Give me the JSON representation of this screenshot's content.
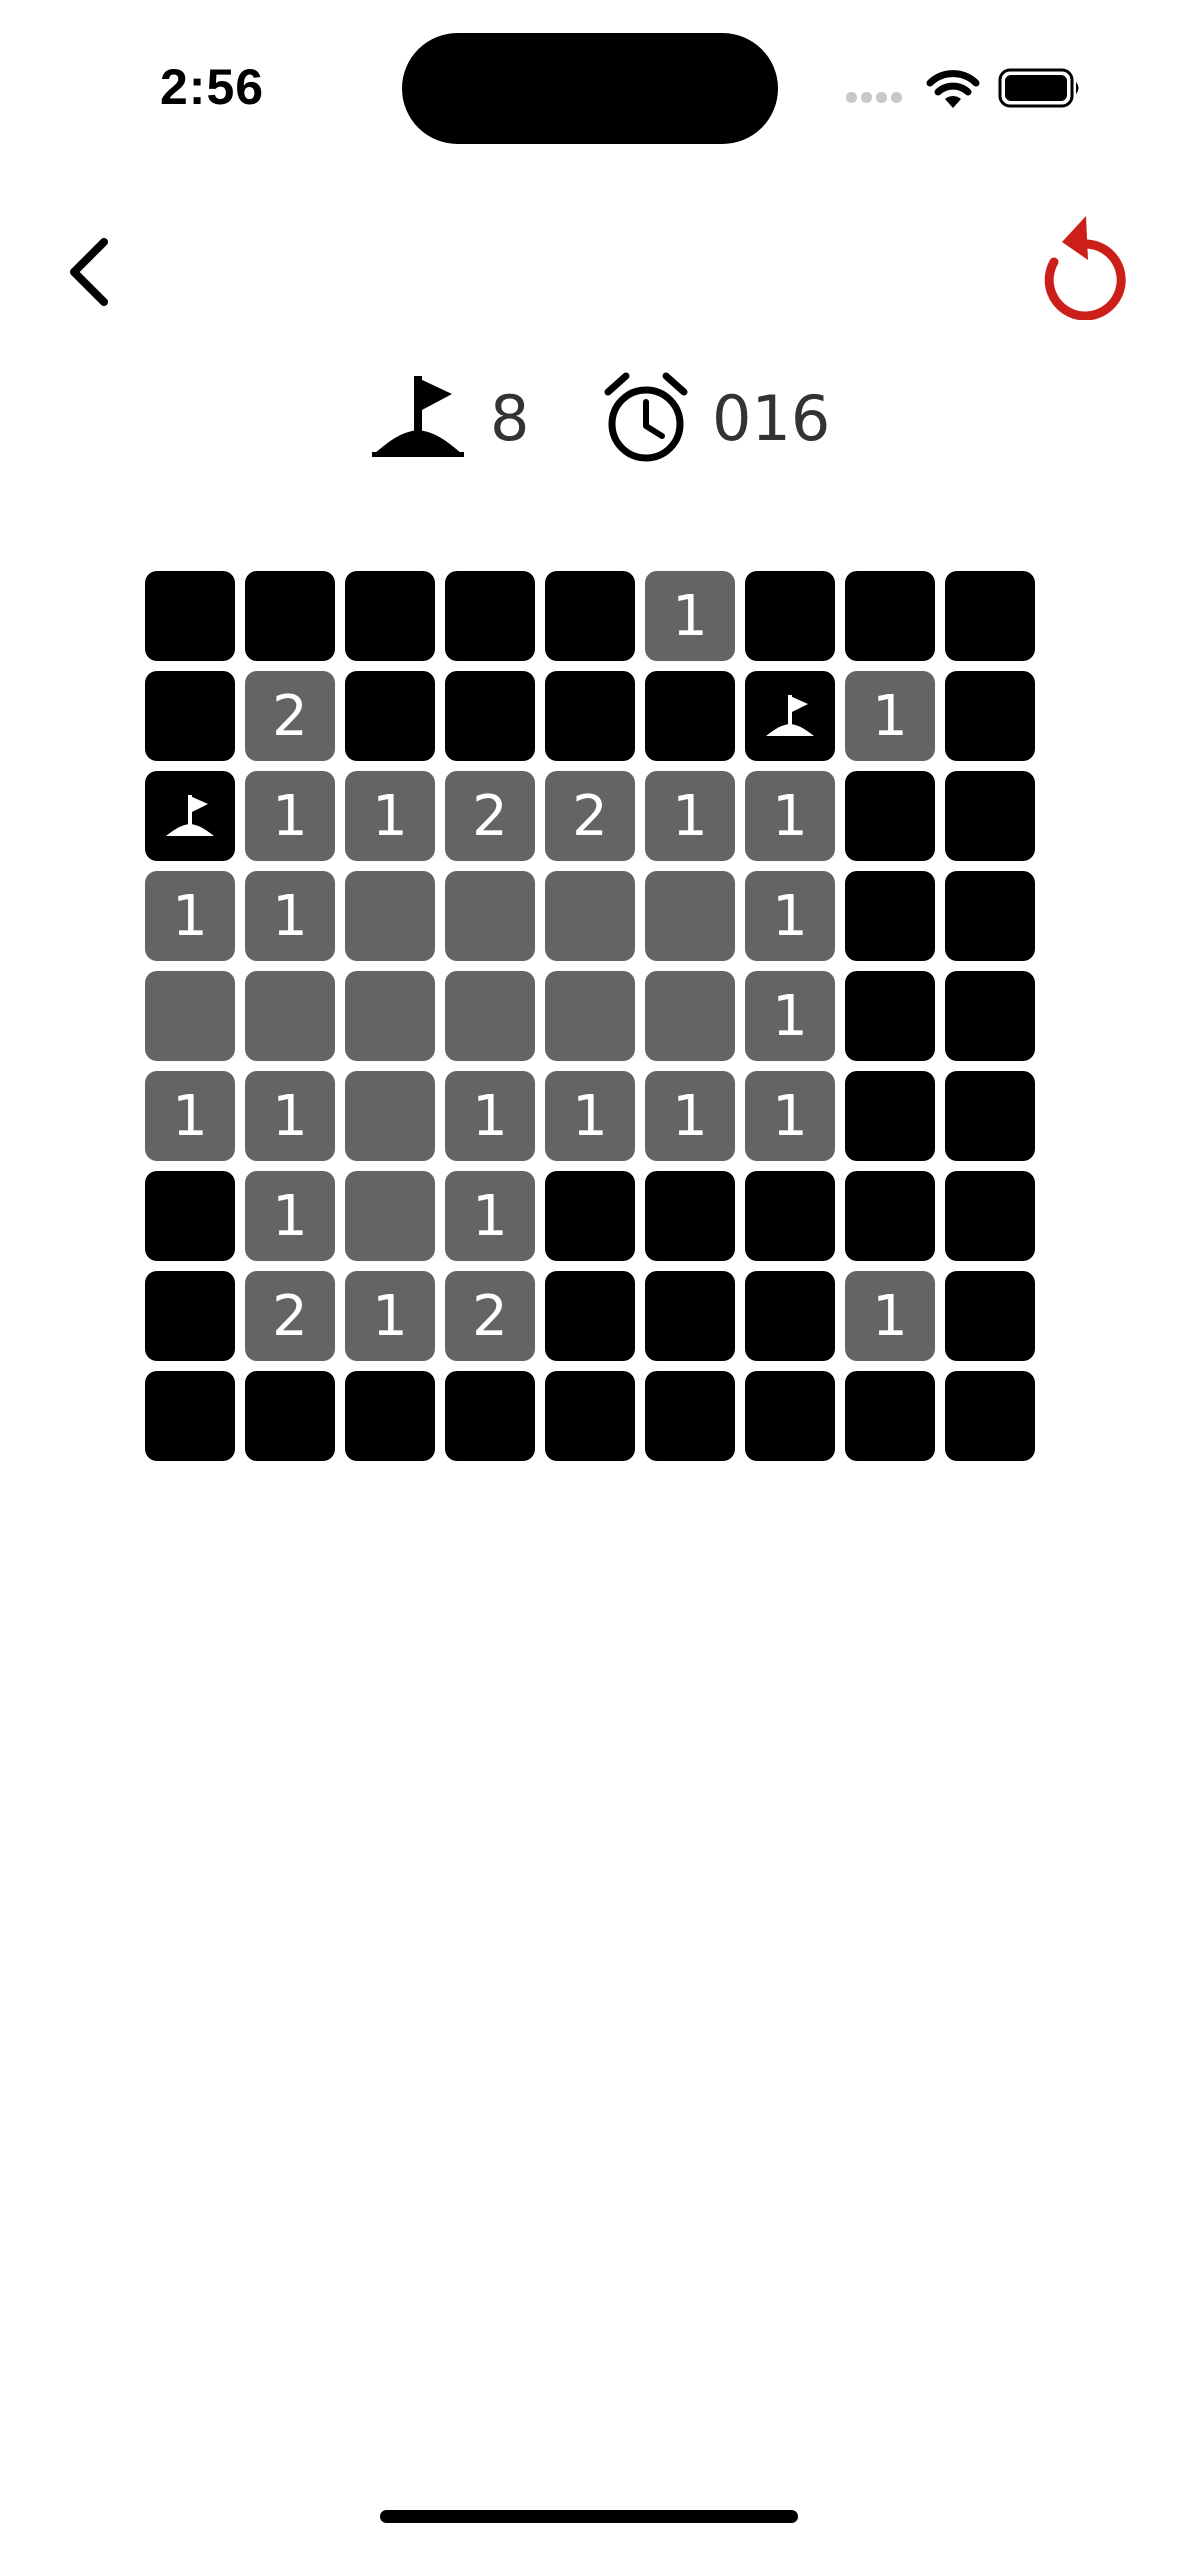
{
  "status_bar": {
    "time": "2:56"
  },
  "header": {
    "restart_color": "#cc1f1a"
  },
  "counters": {
    "flags_remaining": "8",
    "timer": "016"
  },
  "board": {
    "rows": 9,
    "cols": 9,
    "legend": {
      "H": "hidden",
      "F": "flagged",
      "0": "revealed-empty",
      "1-8": "revealed-number"
    },
    "cells": [
      [
        "H",
        "H",
        "H",
        "H",
        "H",
        "1",
        "H",
        "H",
        "H"
      ],
      [
        "H",
        "2",
        "H",
        "H",
        "H",
        "H",
        "F",
        "1",
        "H"
      ],
      [
        "F",
        "1",
        "1",
        "2",
        "2",
        "1",
        "1",
        "H",
        "H"
      ],
      [
        "1",
        "1",
        "0",
        "0",
        "0",
        "0",
        "1",
        "H",
        "H"
      ],
      [
        "0",
        "0",
        "0",
        "0",
        "0",
        "0",
        "1",
        "H",
        "H"
      ],
      [
        "1",
        "1",
        "0",
        "1",
        "1",
        "1",
        "1",
        "H",
        "H"
      ],
      [
        "H",
        "1",
        "0",
        "1",
        "H",
        "H",
        "H",
        "H",
        "H"
      ],
      [
        "H",
        "2",
        "1",
        "2",
        "H",
        "H",
        "H",
        "1",
        "H"
      ],
      [
        "H",
        "H",
        "H",
        "H",
        "H",
        "H",
        "H",
        "H",
        "H"
      ]
    ]
  }
}
